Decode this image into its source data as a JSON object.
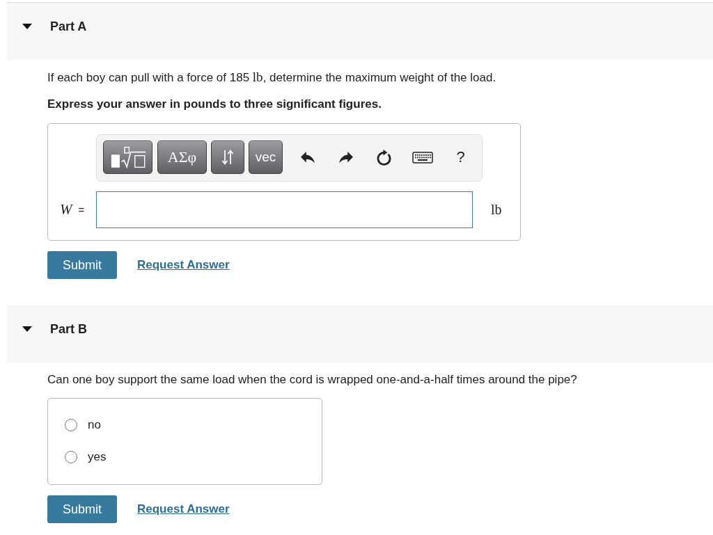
{
  "parts": [
    {
      "kind": "expression",
      "title": "Part A",
      "expanded": true,
      "question": [
        {
          "kind": "text",
          "text": "If each boy can pull with a force of 185 "
        },
        {
          "kind": "math",
          "text": "lb"
        },
        {
          "kind": "text",
          "text": ", determine the maximum weight of the load."
        }
      ],
      "instruction": "Express your answer in pounds to three significant figures.",
      "toolbar": [
        {
          "kind": "templates"
        },
        {
          "kind": "symbols",
          "label": "ΑΣφ"
        },
        {
          "kind": "arrows"
        },
        {
          "kind": "vector",
          "label": "vec"
        },
        {
          "kind": "undo"
        },
        {
          "kind": "redo"
        },
        {
          "kind": "reset"
        },
        {
          "kind": "keyboard"
        },
        {
          "kind": "help",
          "label": "?"
        }
      ],
      "answer": {
        "variable": "W",
        "sign": "=",
        "unit": "lb"
      },
      "actions": {
        "submit": "Submit",
        "request_answer": "Request Answer"
      }
    },
    {
      "kind": "choice",
      "title": "Part B",
      "expanded": true,
      "question": [
        {
          "kind": "text",
          "text": "Can one boy support the same load when the cord is wrapped one-and-a-half times around the pipe?"
        }
      ],
      "options": [
        {
          "label": "no",
          "selected": false
        },
        {
          "label": "yes",
          "selected": false
        }
      ],
      "actions": {
        "submit": "Submit",
        "request_answer": "Request Answer"
      }
    }
  ]
}
